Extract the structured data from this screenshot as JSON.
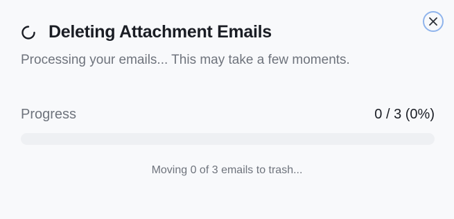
{
  "dialog": {
    "title": "Deleting Attachment Emails",
    "subtitle": "Processing your emails... This may take a few moments.",
    "close_icon": "close-icon",
    "spinner_icon": "spinner-icon"
  },
  "progress": {
    "label": "Progress",
    "count_text": "0 / 3 (0%)",
    "completed": 0,
    "total": 3,
    "fraction": 0
  },
  "status": {
    "text": "Moving 0 of 3 emails to trash..."
  },
  "colors": {
    "accent": "#3b6fd8",
    "close_ring": "#8fb4ec",
    "track": "#eef0f3",
    "title": "#1a1d24",
    "muted": "#6e737c",
    "background": "#f8f9fb"
  }
}
